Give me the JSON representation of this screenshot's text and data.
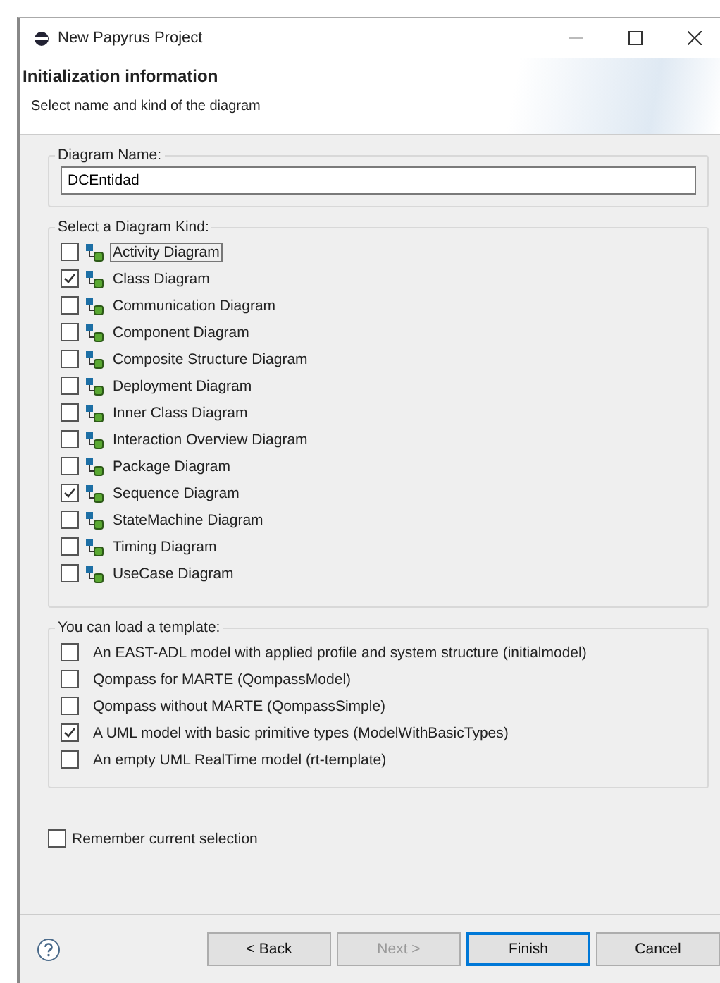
{
  "window": {
    "title": "New Papyrus Project"
  },
  "header": {
    "title": "Initialization information",
    "subtitle": "Select name and kind of the diagram"
  },
  "diagram_name": {
    "label": "Diagram Name:",
    "value": "DCEntidad"
  },
  "diagram_kinds": {
    "label": "Select a Diagram Kind:",
    "items": [
      {
        "label": "Activity Diagram",
        "checked": false,
        "focused": true
      },
      {
        "label": "Class Diagram",
        "checked": true,
        "focused": false
      },
      {
        "label": "Communication Diagram",
        "checked": false,
        "focused": false
      },
      {
        "label": "Component Diagram",
        "checked": false,
        "focused": false
      },
      {
        "label": "Composite Structure Diagram",
        "checked": false,
        "focused": false
      },
      {
        "label": "Deployment Diagram",
        "checked": false,
        "focused": false
      },
      {
        "label": "Inner Class Diagram",
        "checked": false,
        "focused": false
      },
      {
        "label": "Interaction Overview Diagram",
        "checked": false,
        "focused": false
      },
      {
        "label": "Package Diagram",
        "checked": false,
        "focused": false
      },
      {
        "label": "Sequence Diagram",
        "checked": true,
        "focused": false
      },
      {
        "label": "StateMachine Diagram",
        "checked": false,
        "focused": false
      },
      {
        "label": "Timing Diagram",
        "checked": false,
        "focused": false
      },
      {
        "label": "UseCase Diagram",
        "checked": false,
        "focused": false
      }
    ]
  },
  "templates": {
    "label": "You can load a template:",
    "items": [
      {
        "label": "An EAST-ADL model with applied profile and system structure (initialmodel)",
        "checked": false
      },
      {
        "label": "Qompass for MARTE (QompassModel)",
        "checked": false
      },
      {
        "label": "Qompass without MARTE (QompassSimple)",
        "checked": false
      },
      {
        "label": "A UML model with basic primitive types (ModelWithBasicTypes)",
        "checked": true
      },
      {
        "label": "An empty UML RealTime model (rt-template)",
        "checked": false
      }
    ]
  },
  "remember": {
    "label": "Remember current selection",
    "checked": false
  },
  "buttons": [
    {
      "label": "< Back",
      "disabled": false,
      "default": false
    },
    {
      "label": "Next >",
      "disabled": true,
      "default": false
    },
    {
      "label": "Finish",
      "disabled": false,
      "default": true
    },
    {
      "label": "Cancel",
      "disabled": false,
      "default": false
    }
  ]
}
